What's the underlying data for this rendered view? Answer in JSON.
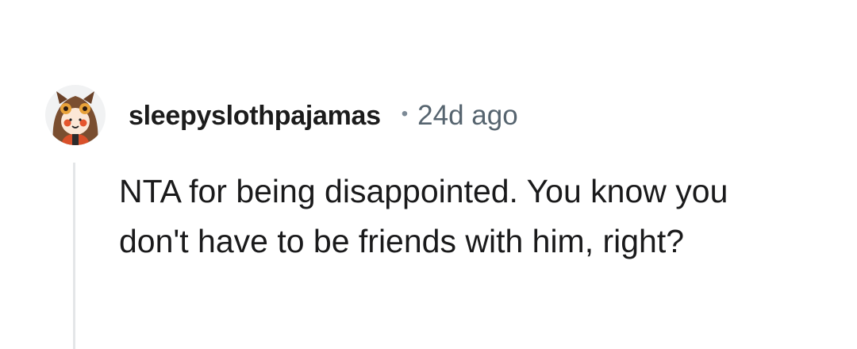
{
  "comment": {
    "author": "sleepyslothpajamas",
    "separator": "•",
    "time_ago": "24d ago",
    "avatar_icon": "owl-hat-avatar-icon",
    "body": "NTA for being disappointed. You know you don't have to be friends with him, right?"
  },
  "colors": {
    "username": "#1c1c1c",
    "timestamp": "#56646f",
    "thread_line": "#e4e6e8",
    "body_text": "#1a1a1b"
  }
}
